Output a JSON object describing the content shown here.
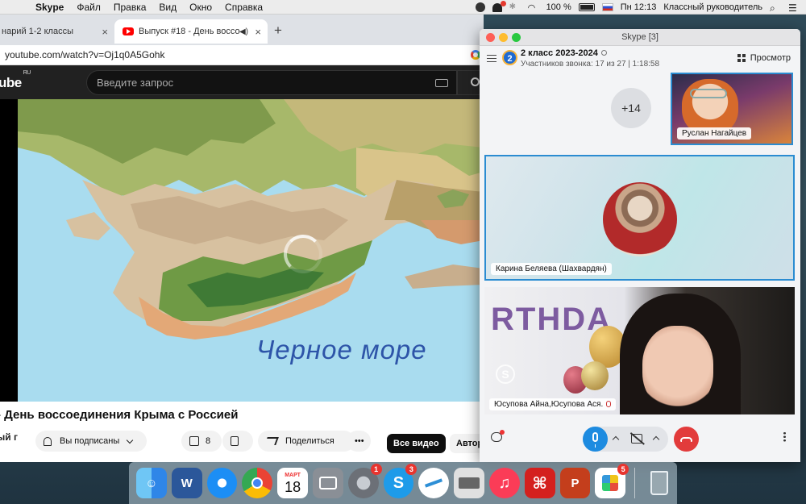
{
  "menubar": {
    "app_name": "Skype",
    "items": [
      "Файл",
      "Правка",
      "Вид",
      "Окно",
      "Справка"
    ],
    "battery": "100 %",
    "clock": "Пн 12:13",
    "user": "Классный руководитель"
  },
  "browser": {
    "tabs": [
      {
        "label": "нарий 1-2 классы"
      },
      {
        "label": "Выпуск #18 - День воссо"
      }
    ],
    "url": "youtube.com/watch?v=Oj1q0A5Gohk",
    "logo": "ube",
    "logo_region": "RU",
    "search_placeholder": "Введите запрос",
    "video": {
      "sea_label": "Черное  море",
      "title": "- День воссоединения Крыма с Россией",
      "channel_trunc": "ый г",
      "subscribed": "Вы подписаны",
      "likes": "8",
      "share": "Поделиться"
    },
    "chips": {
      "all": "Все видео",
      "author": "Автор"
    }
  },
  "skype": {
    "window_title": "Skype [3]",
    "group_title": "2 класс  2023-2024",
    "call_info": "Участников звонка: 17 из 27 | 1:18:58",
    "view_label": "Просмотр",
    "more_participants": "+14",
    "participants": [
      {
        "name": "Руслан Нагайцев"
      },
      {
        "name": "Карина Беляева (Шахвардян)"
      },
      {
        "name": "Юсупова Айна,Юсупова Ася."
      }
    ],
    "birthday_text": "RTHDA",
    "watermark": "S",
    "group_icon_text": "2"
  },
  "dock": {
    "apps": [
      {
        "name": "finder",
        "label": "",
        "color": "#2f86e8"
      },
      {
        "name": "word",
        "label": "W",
        "color": "#2b579a"
      },
      {
        "name": "safari",
        "label": "",
        "color": "#1c8ef5"
      },
      {
        "name": "chrome",
        "label": "",
        "color": "#ffffff"
      },
      {
        "name": "calendar",
        "label": "18",
        "month": "МАРТ"
      },
      {
        "name": "preview",
        "label": "",
        "color": "#8a8f96"
      },
      {
        "name": "system-preferences",
        "label": "",
        "color": "#7c7f85",
        "badge": "1"
      },
      {
        "name": "skype",
        "label": "S",
        "color": "#1e9be9",
        "badge": "3"
      },
      {
        "name": "vpn",
        "label": "",
        "color": "#ffffff"
      },
      {
        "name": "printer",
        "label": "",
        "color": "#e0e0e0"
      },
      {
        "name": "music",
        "label": "♫",
        "color": "#fb3c57"
      },
      {
        "name": "acrobat",
        "label": "",
        "color": "#d4201e"
      },
      {
        "name": "powerpoint",
        "label": "P",
        "color": "#c43e1c"
      },
      {
        "name": "app-store-gift",
        "label": "",
        "color": "#ffffff",
        "badge": "5"
      },
      {
        "name": "trash",
        "label": "",
        "color": "#cfd6dc"
      }
    ]
  }
}
